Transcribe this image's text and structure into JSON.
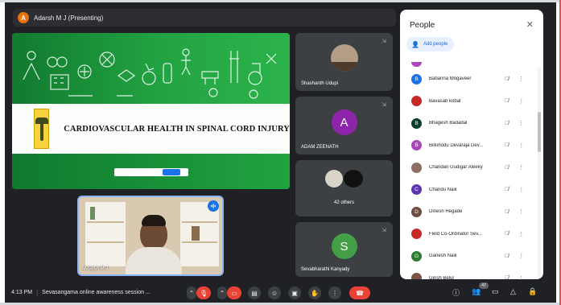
{
  "presenter": {
    "initial": "A",
    "label": "Adarsh M J (Presenting)"
  },
  "slide": {
    "title": "CARDIOVASCULAR HEALTH IN SPINAL CORD INJURY"
  },
  "self_view": {
    "name": "Adarsh M J"
  },
  "tiles": [
    {
      "name": "Shashanth Udupi"
    },
    {
      "name": "ADAM ZEENATH",
      "initial": "A",
      "color": "#8e24aa"
    },
    {
      "name": "42 others"
    },
    {
      "name": "Sevabharathi Kanyady",
      "initial": "S",
      "color": "#43a047"
    }
  ],
  "people_panel": {
    "title": "People",
    "add_label": "Add people",
    "participants": [
      {
        "name": "Babanna Mogaveer",
        "initial": "B",
        "color": "#1a73e8"
      },
      {
        "name": "Bavasab kobal",
        "initial": "",
        "color": "#c62828"
      },
      {
        "name": "Bhagesh Badadal",
        "initial": "B",
        "color": "#0b3d2e"
      },
      {
        "name": "Billohodu Devaraja Dev...",
        "initial": "B",
        "color": "#ab47bc"
      },
      {
        "name": "Chandan Gudigar Aleeky",
        "initial": "",
        "color": "#8d6e63"
      },
      {
        "name": "Chandu Naik",
        "initial": "C",
        "color": "#5e35b1"
      },
      {
        "name": "Dinesh Hegade",
        "initial": "D",
        "color": "#6d4c41"
      },
      {
        "name": "Field Co-Ordinator Sev...",
        "initial": "",
        "color": "#c62828"
      },
      {
        "name": "Ganesh Naik",
        "initial": "G",
        "color": "#2e7d32"
      },
      {
        "name": "Girish Belur",
        "initial": "",
        "color": "#795548"
      }
    ]
  },
  "bottom_bar": {
    "time": "4:13 PM",
    "meeting": "Sevasangama online awareness session ...",
    "participant_count": "47"
  },
  "colors": {
    "accent": "#1a73e8",
    "danger": "#ea4335",
    "background": "#202124"
  }
}
